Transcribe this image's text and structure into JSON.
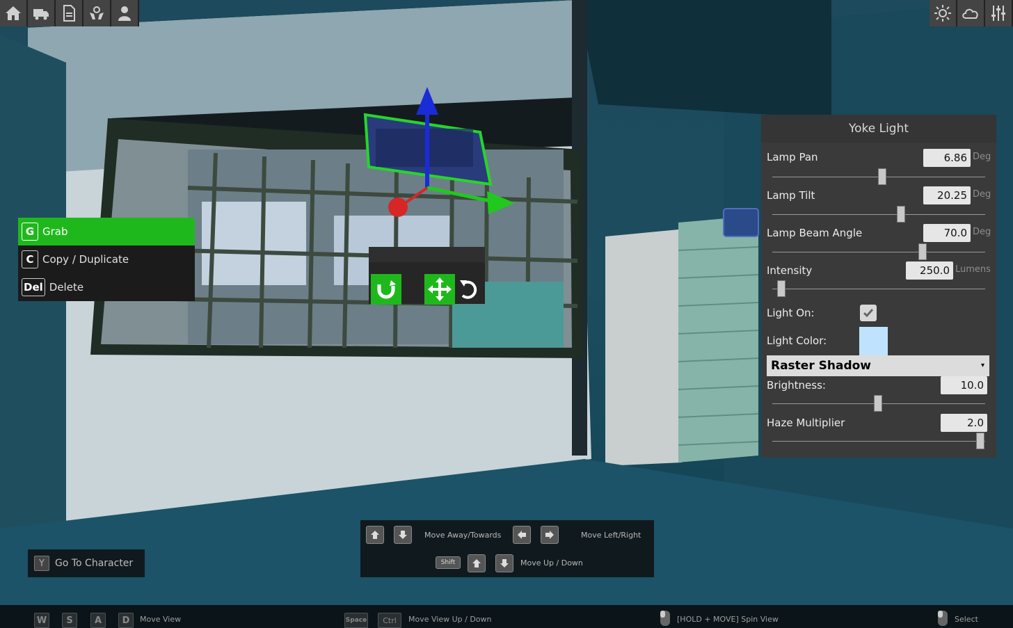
{
  "toolbar_left": [
    {
      "icon": "home-icon"
    },
    {
      "icon": "truck-icon"
    },
    {
      "icon": "document-icon"
    },
    {
      "icon": "hands-icon"
    },
    {
      "icon": "character-icon"
    }
  ],
  "toolbar_right": [
    {
      "icon": "sun-icon"
    },
    {
      "icon": "cloud-icon"
    },
    {
      "icon": "sliders-icon"
    }
  ],
  "context_menu": {
    "items": [
      {
        "key": "G",
        "label": "Grab",
        "active": true
      },
      {
        "key": "C",
        "label": "Copy / Duplicate",
        "active": false
      },
      {
        "key": "Del",
        "label": "Delete",
        "active": false
      }
    ]
  },
  "panel": {
    "title": "Yoke Light",
    "lamp_pan": {
      "label": "Lamp Pan",
      "value": "6.86",
      "unit": "Deg"
    },
    "lamp_tilt": {
      "label": "Lamp Tilt",
      "value": "20.25",
      "unit": "Deg"
    },
    "lamp_beam_angle": {
      "label": "Lamp Beam Angle",
      "value": "70.0",
      "unit": "Deg"
    },
    "intensity": {
      "label": "Intensity",
      "value": "250.0",
      "unit": "Lumens"
    },
    "light_on": {
      "label": "Light On:",
      "checked": true
    },
    "light_color": {
      "label": "Light Color:",
      "color": "#bfe3ff"
    },
    "shadow_mode": {
      "selected": "Raster Shadow"
    },
    "brightness": {
      "label": "Brightness:",
      "value": "10.0"
    },
    "haze_multiplier": {
      "label": "Haze Multiplier",
      "value": "2.0"
    }
  },
  "move_hints": {
    "away_towards": "Move Away/Towards",
    "left_right": "Move Left/Right",
    "shift_key": "Shift",
    "up_down": "Move Up / Down"
  },
  "goto_character": {
    "key": "Y",
    "label": "Go To Character"
  },
  "bottom_bar": {
    "keys_wasd": [
      "W",
      "S",
      "A",
      "D"
    ],
    "move_view": "Move View",
    "space_key": "Space",
    "ctrl_key": "Ctrl",
    "move_view_updown": "Move View Up / Down",
    "spin_view": "[HOLD + MOVE] Spin View",
    "select": "Select"
  },
  "colors": {
    "accent_green": "#1fb81c",
    "panel_bg": "#3a3a3a"
  }
}
